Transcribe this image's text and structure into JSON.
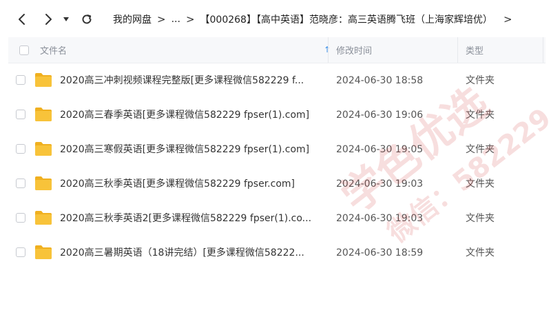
{
  "toolbar": {
    "back_icon": "chevron-left-icon",
    "forward_icon": "chevron-right-icon",
    "history_icon": "dropdown-caret-icon",
    "refresh_icon": "refresh-icon"
  },
  "breadcrumb": {
    "items": [
      "我的网盘",
      "...",
      "【000268】【高中英语】范晓彦：高三英语腾飞班（上海家辉培优）"
    ],
    "separator": ">",
    "trailing": ">"
  },
  "table": {
    "headers": {
      "name": "文件名",
      "modified": "修改时间",
      "type": "类型"
    },
    "sort_indicator": "↑",
    "rows": [
      {
        "name": "2020高三冲刺视频课程完整版[更多课程微信582229 f...",
        "modified": "2024-06-30 18:58",
        "type": "文件夹"
      },
      {
        "name": "2020高三春季英语[更多课程微信582229 fpser(1).com]",
        "modified": "2024-06-30 19:06",
        "type": "文件夹"
      },
      {
        "name": "2020高三寒假英语[更多课程微信582229 fpser(1).com]",
        "modified": "2024-06-30 19:05",
        "type": "文件夹"
      },
      {
        "name": "2020高三秋季英语[更多课程微信582229 fpser.com]",
        "modified": "2024-06-30 19:03",
        "type": "文件夹"
      },
      {
        "name": "2020高三秋季英语2[更多课程微信582229 fpser(1).co...",
        "modified": "2024-06-30 19:03",
        "type": "文件夹"
      },
      {
        "name": "2020高三暑期英语（18讲完结）[更多课程微信58222...",
        "modified": "2024-06-30 18:59",
        "type": "文件夹"
      }
    ]
  },
  "watermark": {
    "line1": "学色优选",
    "line2": "微信：582229"
  },
  "colors": {
    "folder": "#f8c33a",
    "folder_tab": "#f0b020",
    "accent": "#3a8ee6",
    "watermark": "#d23a3a"
  }
}
